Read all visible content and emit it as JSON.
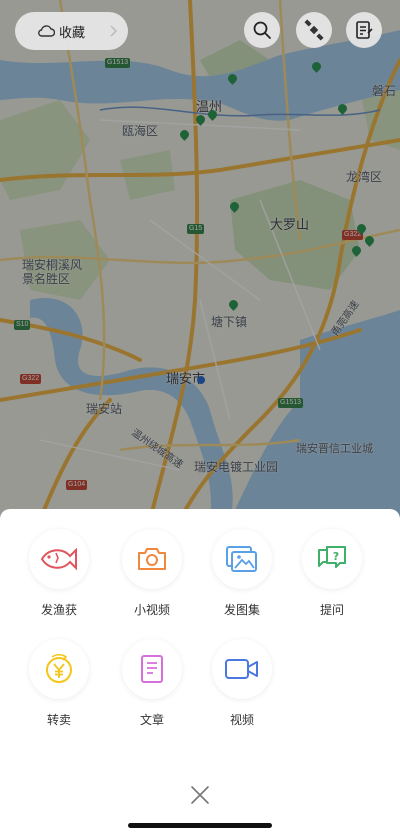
{
  "top_bar": {
    "favorites_label": "收藏",
    "icons": [
      "cloud-icon",
      "chevron-right-icon",
      "search-icon",
      "satellite-icon",
      "note-icon"
    ]
  },
  "map": {
    "labels": {
      "wenzhou": "温州",
      "ouhai": "瓯海区",
      "longwan": "龙湾区",
      "daluoshan": "大罗山",
      "ruian_scenic": "瑞安桐溪风\n景名胜区",
      "tangxia": "塘下镇",
      "ruian_city": "瑞安市",
      "ruian_station": "瑞安站",
      "ruian_industrial": "瑞安电镀工业园",
      "ruian_zhangu": "瑞安晋信工业城",
      "pan": "磐石",
      "wenzhou_coast": "温州绕城高速",
      "g15": "G15",
      "g1513": "G1513",
      "g1513b": "G1513",
      "s10": "S10",
      "g322": "G322",
      "g322b": "G322",
      "g104": "G104",
      "coastal": "甬莞高速"
    }
  },
  "sheet": {
    "actions": [
      {
        "label": "发渔获",
        "icon": "fish-icon"
      },
      {
        "label": "小视频",
        "icon": "camera-icon"
      },
      {
        "label": "发图集",
        "icon": "gallery-icon"
      },
      {
        "label": "提问",
        "icon": "question-icon"
      },
      {
        "label": "转卖",
        "icon": "yen-coin-icon"
      },
      {
        "label": "文章",
        "icon": "article-icon"
      },
      {
        "label": "视频",
        "icon": "video-icon"
      }
    ],
    "close_icon": "close-icon"
  }
}
